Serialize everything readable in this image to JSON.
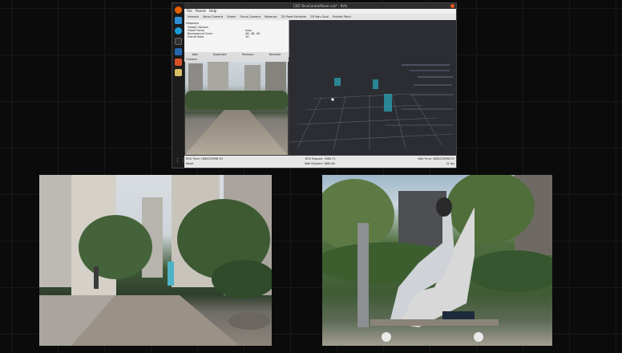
{
  "window": {
    "title": "[3D] TenxControlPanel.rviz* - RViz",
    "menu": [
      "File",
      "Panels",
      "Help"
    ],
    "toolbar": [
      "Interact",
      "Move Camera",
      "Select",
      "Focus Camera",
      "Measure",
      "2D Pose Estimate",
      "2D Nav Goal",
      "Publish Point"
    ]
  },
  "displays": {
    "header": "Displays",
    "rows": [
      {
        "label": "Global Options",
        "value": ""
      },
      {
        "label": "Fixed Frame",
        "value": "map"
      },
      {
        "label": "Background Color",
        "value": "48; 48; 48"
      },
      {
        "label": "Frame Rate",
        "value": "30"
      }
    ],
    "buttons": [
      "Add",
      "Duplicate",
      "Remove",
      "Rename"
    ]
  },
  "camera_panel": {
    "label": "Camera"
  },
  "statusbar": {
    "left": "ROS Time: 1684230998.94",
    "elapsed": "ROS Elapsed: 1684.71",
    "wall": "Wall Time: 1684230998.97",
    "wall_elapsed": "Wall Elapsed: 1684.64",
    "fps": "31 fps",
    "reset": "Reset"
  },
  "colors": {
    "accent": "#e95420",
    "obstacle": "#2aa3b6",
    "point_cloud": "#7a7f9a"
  },
  "dock_icons": [
    "firefox-icon",
    "files-icon",
    "settings-icon",
    "terminal-icon",
    "rviz-icon",
    "text-editor-icon",
    "apps-grid-icon"
  ]
}
